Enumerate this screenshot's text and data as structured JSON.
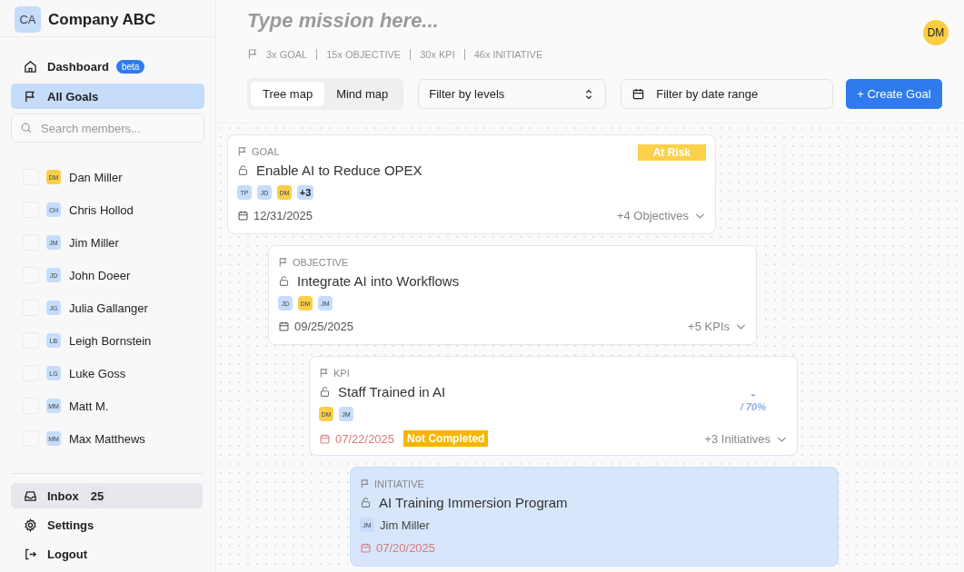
{
  "sidebar": {
    "org": {
      "initials": "CA",
      "name": "Company ABC"
    },
    "nav": [
      {
        "kind": "home",
        "label": "Dashboard",
        "badge": "beta",
        "selected": false
      },
      {
        "kind": "flag",
        "label": "All Goals",
        "selected": true
      }
    ],
    "search": {
      "placeholder": "Search members..."
    },
    "members": [
      {
        "initials": "DM",
        "name": "Dan Miller",
        "color": "#f9cf4a",
        "checked": false
      },
      {
        "initials": "CH",
        "name": "Chris Hollod",
        "color": "#c6dcfb",
        "checked": false
      },
      {
        "initials": "JM",
        "name": "Jim Miller",
        "color": "#c6dcfb",
        "checked": false
      },
      {
        "initials": "JD",
        "name": "John Doeer",
        "color": "#c6dcfb",
        "checked": false
      },
      {
        "initials": "JG",
        "name": "Julia Gallanger",
        "color": "#c6dcfb",
        "checked": false
      },
      {
        "initials": "LB",
        "name": "Leigh Bornstein",
        "color": "#c6dcfb",
        "checked": false
      },
      {
        "initials": "LG",
        "name": "Luke Goss",
        "color": "#c6dcfb",
        "checked": false
      },
      {
        "initials": "MM",
        "name": "Matt M.",
        "color": "#c6dcfb",
        "checked": false
      },
      {
        "initials": "MM",
        "name": "Max Matthews",
        "color": "#c6dcfb",
        "checked": false
      }
    ],
    "footer": [
      {
        "kind": "inbox",
        "label": "Inbox",
        "count": "25",
        "hovered": true
      },
      {
        "kind": "settings",
        "label": "Settings",
        "hovered": false
      },
      {
        "kind": "logout",
        "label": "Logout",
        "hovered": false
      }
    ]
  },
  "header": {
    "mission": {
      "placeholder": "Type mission here..."
    },
    "user": {
      "initials": "DM"
    },
    "stats": [
      "3x GOAL",
      "15x OBJECTIVE",
      "30x KPI",
      "46x INITIATIVE"
    ]
  },
  "toolbar": {
    "views": [
      {
        "label": "Tree map",
        "selected": true
      },
      {
        "label": "Mind map",
        "selected": false
      }
    ],
    "level_filter": {
      "placeholder": "Filter by levels"
    },
    "date_filter": {
      "placeholder": "Filter by date range"
    },
    "create_button": "+ Create Goal"
  },
  "tree": [
    {
      "level": "GOAL",
      "title": "Enable AI to Reduce OPEX",
      "status": {
        "label": "At Risk",
        "color": "#fbd14b"
      },
      "owners": [
        {
          "initials": "TP",
          "color": "#c6dcfb"
        },
        {
          "initials": "JD",
          "color": "#c6dcfb"
        },
        {
          "initials": "DM",
          "color": "#f9cf4a"
        }
      ],
      "more_owners": "+3",
      "date": "12/31/2025",
      "overdue": false,
      "selected": false,
      "children_label": "+4 Objectives",
      "children": [
        {
          "level": "OBJECTIVE",
          "title": "Integrate AI into Workflows",
          "owners": [
            {
              "initials": "JD",
              "color": "#c6dcfb"
            },
            {
              "initials": "DM",
              "color": "#f9cf4a"
            },
            {
              "initials": "JM",
              "color": "#c6dcfb"
            }
          ],
          "date": "09/25/2025",
          "overdue": false,
          "selected": false,
          "children_label": "+5 KPIs",
          "children": [
            {
              "level": "KPI",
              "title": "Staff Trained in AI",
              "owners": [
                {
                  "initials": "DM",
                  "color": "#f9cf4a"
                },
                {
                  "initials": "JM",
                  "color": "#c6dcfb"
                }
              ],
              "progress": {
                "value": "-",
                "target": "/ 70%"
              },
              "date": "07/22/2025",
              "overdue": true,
              "date_badge": {
                "label": "Not Completed",
                "color": "#f7b500"
              },
              "selected": false,
              "children_label": "+3 Initiatives",
              "children": [
                {
                  "level": "INITIATIVE",
                  "title": "AI Training Immersion Program",
                  "owners": [
                    {
                      "initials": "JM",
                      "name": "Jim Miller",
                      "color": "#c6dcfb"
                    }
                  ],
                  "date": "07/20/2025",
                  "overdue": true,
                  "selected": true
                }
              ]
            }
          ]
        }
      ]
    }
  ]
}
